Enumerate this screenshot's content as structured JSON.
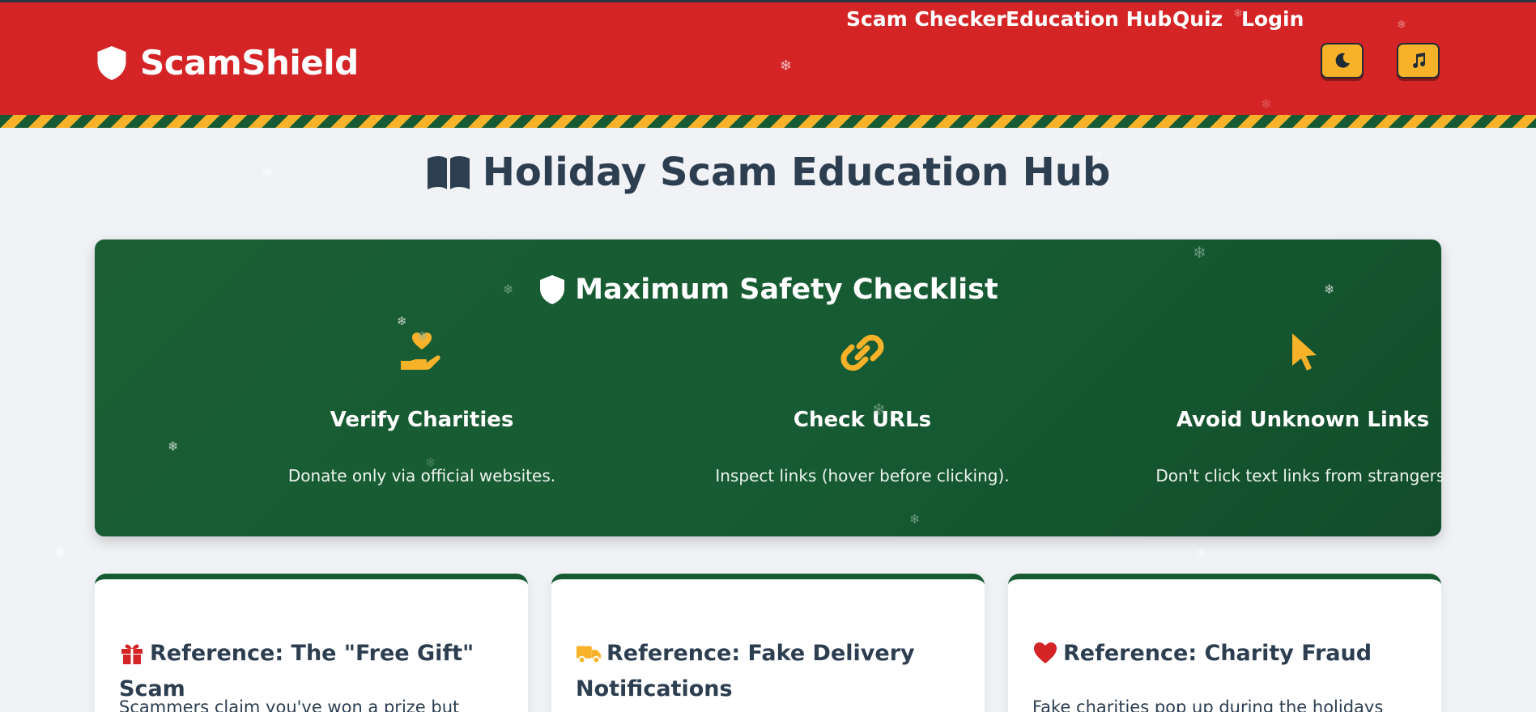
{
  "header": {
    "brand": "ScamShield",
    "nav": [
      "Scam Checker",
      "Education Hub",
      "Quiz",
      "Login"
    ],
    "theme_toggle_icon": "moon-icon",
    "music_toggle_icon": "music-note-icon"
  },
  "page": {
    "title": "Holiday Scam Education Hub",
    "title_icon": "book-open-icon"
  },
  "checklist": {
    "title": "Maximum Safety Checklist",
    "items": [
      {
        "icon": "hand-holding-heart-icon",
        "title": "Verify Charities",
        "text": "Donate only via official websites."
      },
      {
        "icon": "link-icon",
        "title": "Check URLs",
        "text": "Inspect links (hover before clicking)."
      },
      {
        "icon": "mouse-pointer-icon",
        "title": "Avoid Unknown Links",
        "text": "Don't click text links from strangers."
      }
    ]
  },
  "cards": [
    {
      "icon": "gift-icon",
      "title": "Reference: The \"Free Gift\" Scam",
      "text": "Scammers claim you've won a prize but"
    },
    {
      "icon": "delivery-truck-icon",
      "title": "Reference: Fake Delivery Notifications",
      "text": ""
    },
    {
      "icon": "heart-icon",
      "title": "Reference: Charity Fraud",
      "text": "Fake charities pop up during the holidays"
    }
  ],
  "colors": {
    "header_red": "#d42426",
    "forest_green": "#165b33",
    "gold": "#f8b229",
    "page_bg": "#f0f2f5",
    "text_dark": "#2c3e50"
  }
}
